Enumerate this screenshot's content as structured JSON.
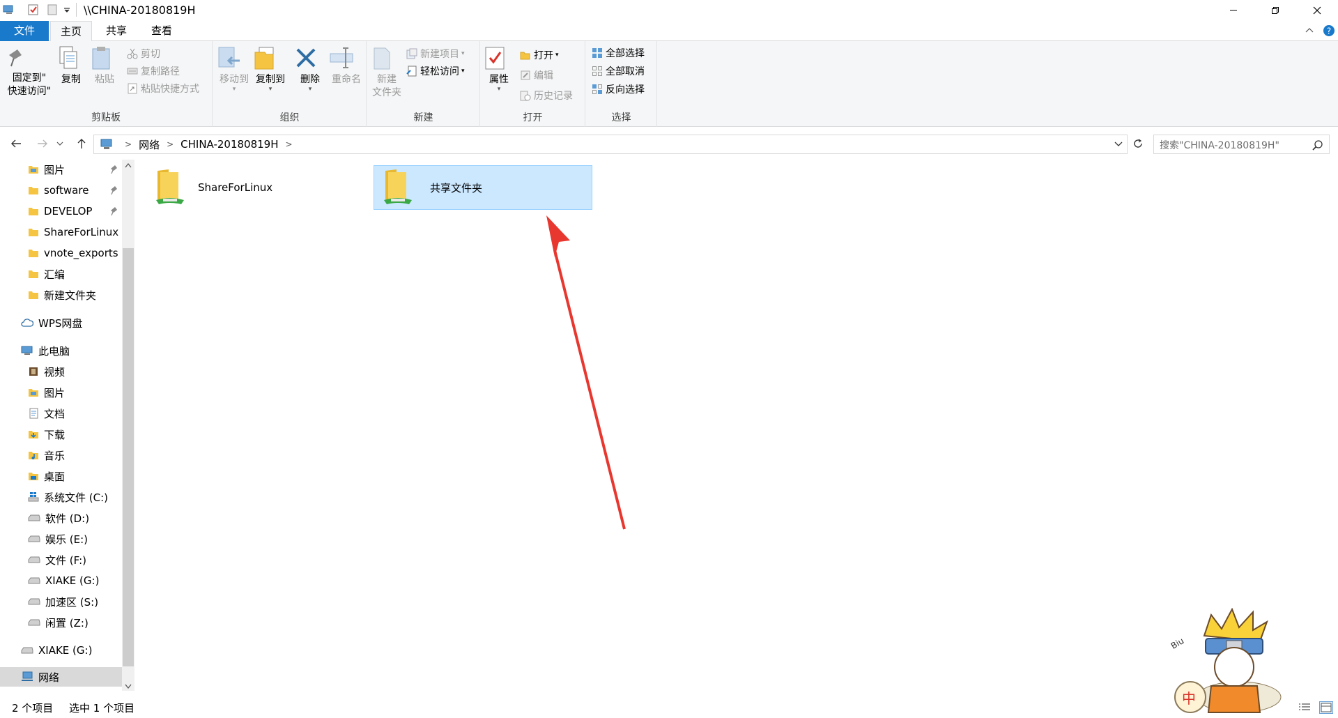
{
  "titlebar": {
    "path": "\\\\CHINA-20180819H",
    "icons": [
      "computer-icon",
      "properties-check-icon",
      "new-folder-icon",
      "qat-dropdown-icon"
    ],
    "controls": [
      "minimize-icon",
      "restore-icon",
      "close-icon"
    ]
  },
  "tabs": [
    {
      "label": "文件"
    },
    {
      "label": "主页"
    },
    {
      "label": "共享"
    },
    {
      "label": "查看"
    }
  ],
  "ribbon": {
    "clipboard": {
      "group": "剪贴板",
      "pin": "固定到\"\n快速访问\"",
      "copy": "复制",
      "paste": "粘贴",
      "cut": "剪切",
      "copy_path": "复制路径",
      "paste_shortcut": "粘贴快捷方式"
    },
    "organize": {
      "group": "组织",
      "move_to": "移动到",
      "copy_to": "复制到",
      "delete": "删除",
      "rename": "重命名"
    },
    "new": {
      "group": "新建",
      "new_folder": "新建\n文件夹",
      "new_item": "新建项目",
      "easy_access": "轻松访问"
    },
    "open": {
      "group": "打开",
      "properties": "属性",
      "open": "打开",
      "edit": "编辑",
      "history": "历史记录"
    },
    "select": {
      "group": "选择",
      "select_all": "全部选择",
      "select_none": "全部取消",
      "invert": "反向选择"
    }
  },
  "address": {
    "crumbs": [
      "网络",
      "CHINA-20180819H"
    ],
    "search_placeholder": "搜索\"CHINA-20180819H\""
  },
  "navpane": {
    "quick_access": [
      {
        "label": "图片",
        "pinned": true
      },
      {
        "label": "software",
        "pinned": true
      },
      {
        "label": "DEVELOP",
        "pinned": true
      },
      {
        "label": "ShareForLinux",
        "pinned": false
      },
      {
        "label": "vnote_exports",
        "pinned": false
      },
      {
        "label": "汇编",
        "pinned": false
      },
      {
        "label": "新建文件夹",
        "pinned": false
      }
    ],
    "wps": "WPS网盘",
    "this_pc": "此电脑",
    "pc_items": [
      "视频",
      "图片",
      "文档",
      "下载",
      "音乐",
      "桌面",
      "系统文件 (C:)",
      "软件 (D:)",
      "娱乐 (E:)",
      "文件 (F:)",
      "XIAKE (G:)",
      "加速区 (S:)",
      "闲置 (Z:)"
    ],
    "xiake": "XIAKE (G:)",
    "network": "网络"
  },
  "content": {
    "items": [
      {
        "name": "ShareForLinux",
        "selected": false
      },
      {
        "name": "共享文件夹",
        "selected": true
      }
    ],
    "annotation_arrow_color": "#e8372f"
  },
  "status": {
    "count": "2 个项目",
    "selection": "选中 1 个项目"
  },
  "tray": {
    "ime": "中",
    "mascot_text": "Biu"
  },
  "colors": {
    "file_tab": "#1979ca",
    "selection": "#cce8ff",
    "folder": "#f5c542",
    "network_green": "#3aa845"
  }
}
